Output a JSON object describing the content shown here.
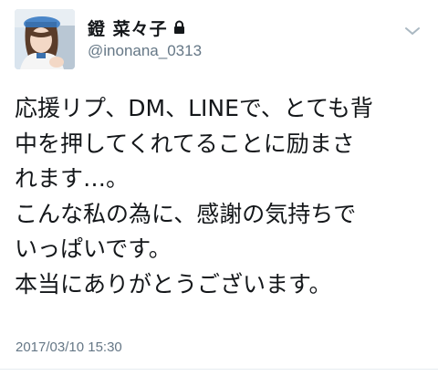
{
  "tweet": {
    "user": {
      "display_name": "鐙 菜々子",
      "handle": "@inonana_0313",
      "protected_icon": "lock-icon",
      "avatar_icon": "profile-photo"
    },
    "menu_icon": "chevron-down-icon",
    "text_lines": [
      "応援リプ、DM、LINEで、とても背",
      "中を押してくれてることに励まさ",
      "れます…。",
      "こんな私の為に、感謝の気持ちで",
      "いっぱいです。",
      "本当にありがとうございます。"
    ],
    "timestamp": "2017/03/10 15:30"
  }
}
